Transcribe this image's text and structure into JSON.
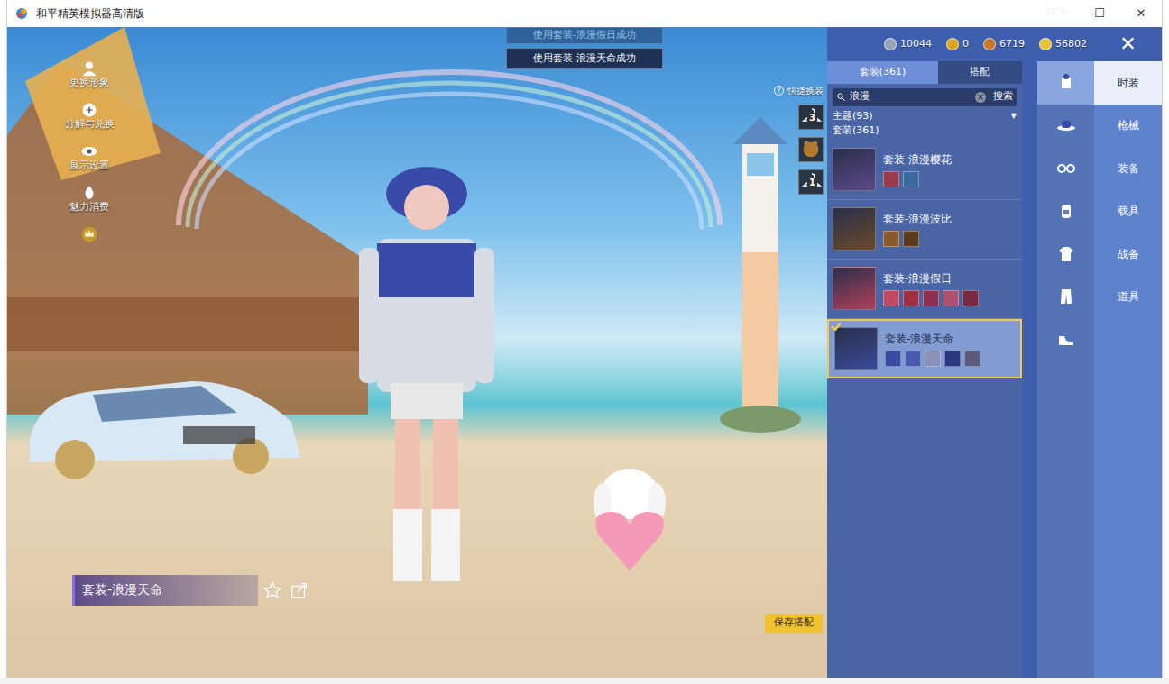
{
  "window": {
    "title": "和平精英模拟器高清版",
    "controls": [
      "—",
      "☐",
      "✕"
    ]
  },
  "toasts": [
    {
      "text": "使用套装-浪漫假日成功",
      "faded": true
    },
    {
      "text": "使用套装-浪漫天命成功",
      "faded": false
    }
  ],
  "left_menu": [
    {
      "label": "更换形象"
    },
    {
      "label": "分解与兑换"
    },
    {
      "label": "展示设置"
    },
    {
      "label": "魅力消费"
    }
  ],
  "currencies": [
    {
      "value": "10044",
      "color": "#9aa3b5"
    },
    {
      "value": "0",
      "color": "#d9a520"
    },
    {
      "value": "6719",
      "color": "#c9782a"
    },
    {
      "value": "56802",
      "color": "#e6c43a"
    }
  ],
  "close": "✕",
  "quick_change": {
    "label": "快捷换装",
    "help": "?",
    "counts": [
      "3",
      "1"
    ]
  },
  "panel": {
    "tabs": [
      {
        "label": "套装(361)",
        "selected": true
      },
      {
        "label": "搭配",
        "selected": false
      }
    ],
    "search": {
      "value": "浪漫",
      "clear": "×",
      "button": "搜索"
    },
    "filter": {
      "label": "主题(93)",
      "arrow": "▼"
    },
    "section": "套装(361)",
    "items": [
      {
        "name": "套装-浪漫樱花",
        "selected": false,
        "color": "#5a4a8a",
        "pieces": [
          "#9a3a4a",
          "#3a6aa0"
        ]
      },
      {
        "name": "套装-浪漫波比",
        "selected": false,
        "color": "#6a4a2a",
        "pieces": [
          "#8a5a2a",
          "#5a3a1a"
        ]
      },
      {
        "name": "套装-浪漫假日",
        "selected": false,
        "color": "#b0405a",
        "pieces": [
          "#c04a60",
          "#a03040",
          "#903050",
          "#b05070",
          "#7a2a40"
        ]
      },
      {
        "name": "套装-浪漫天命",
        "selected": true,
        "color": "#3a4a9a",
        "pieces": [
          "#3a4aa0",
          "#4a5ab0",
          "#8a90b8",
          "#2a3a80",
          "#5a5a7a"
        ]
      }
    ]
  },
  "category_icons": [
    {
      "selected": true
    },
    {
      "selected": false
    },
    {
      "selected": false
    },
    {
      "selected": false
    },
    {
      "selected": false
    },
    {
      "selected": false
    },
    {
      "selected": false
    }
  ],
  "categories": [
    {
      "label": "时装",
      "selected": true
    },
    {
      "label": "枪械",
      "selected": false
    },
    {
      "label": "装备",
      "selected": false
    },
    {
      "label": "载具",
      "selected": false
    },
    {
      "label": "战备",
      "selected": false
    },
    {
      "label": "道具",
      "selected": false
    }
  ],
  "selection": {
    "name": "套装-浪漫天命",
    "favorite": false
  },
  "save_button": "保存搭配"
}
